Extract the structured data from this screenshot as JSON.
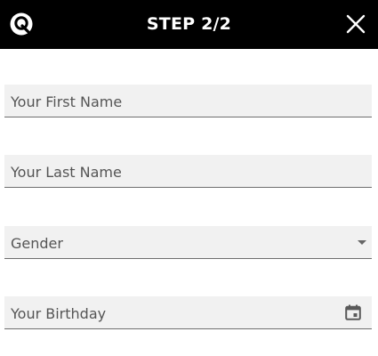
{
  "header": {
    "title": "STEP 2/2",
    "logo_icon": "app-logo-icon",
    "close_icon": "close-icon",
    "background": "#000000"
  },
  "form": {
    "first_name": {
      "placeholder": "Your First Name"
    },
    "last_name": {
      "placeholder": "Your Last Name"
    },
    "gender": {
      "placeholder": "Gender",
      "icon": "dropdown-arrow-icon"
    },
    "birthday": {
      "placeholder": "Your Birthday",
      "icon": "calendar-icon"
    }
  }
}
